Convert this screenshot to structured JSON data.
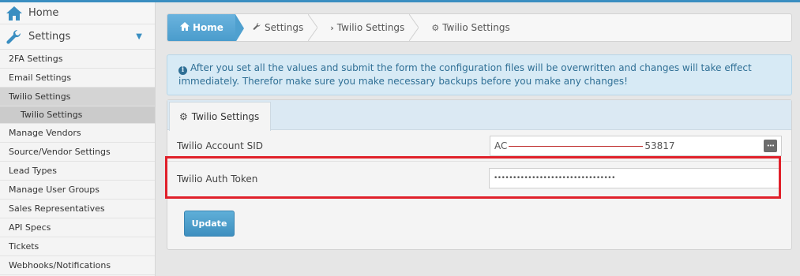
{
  "sidebar": {
    "home_label": "Home",
    "settings_label": "Settings",
    "items": [
      {
        "label": "2FA Settings"
      },
      {
        "label": "Email Settings"
      },
      {
        "label": "Twilio Settings"
      },
      {
        "label": "Twilio Settings"
      },
      {
        "label": "Manage Vendors"
      },
      {
        "label": "Source/Vendor Settings"
      },
      {
        "label": "Lead Types"
      },
      {
        "label": "Manage User Groups"
      },
      {
        "label": "Sales Representatives"
      },
      {
        "label": "API Specs"
      },
      {
        "label": "Tickets"
      },
      {
        "label": "Webhooks/Notifications"
      }
    ]
  },
  "breadcrumb": {
    "home": "Home",
    "settings": "Settings",
    "twilio": "Twilio Settings",
    "current": "Twilio Settings"
  },
  "info": {
    "text": "After you set all the values and submit the form the configuration files will be overwritten and changes will take effect immediately. Therefor make sure you make necessary backups before you make any changes!"
  },
  "panel": {
    "tab_label": "Twilio Settings",
    "fields": {
      "sid_label": "Twilio Account SID",
      "sid_prefix": "AC",
      "sid_suffix": "53817",
      "token_label": "Twilio Auth Token",
      "token_value": "••••••••••••••••••••••••••••••••"
    },
    "update_label": "Update"
  },
  "colors": {
    "accent": "#3a8ec1",
    "highlight": "#e0202a",
    "info_bg": "#d7eaf5"
  }
}
